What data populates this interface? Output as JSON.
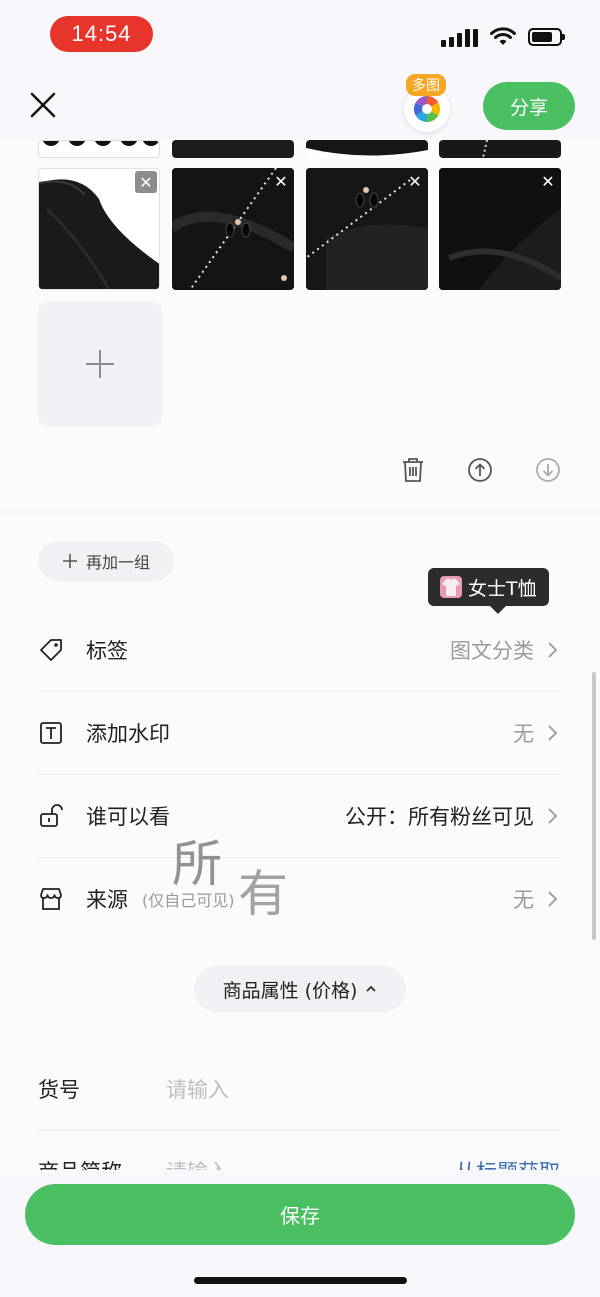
{
  "status_bar": {
    "time": "14:54"
  },
  "nav": {
    "multi_badge": "多图",
    "share_label": "分享"
  },
  "add_group_label": "再加一组",
  "tooltip": {
    "text": "女士T恤"
  },
  "rows": [
    {
      "label": "标签",
      "value": "图文分类"
    },
    {
      "label": "添加水印",
      "value": "无"
    },
    {
      "label": "谁可以看",
      "value": "公开：所有粉丝可见"
    },
    {
      "label": "来源",
      "sub": "(仅自己可见)",
      "value": "无"
    }
  ],
  "overlay": {
    "char1": "所",
    "char2": "有"
  },
  "attr_toggle": {
    "label": "商品属性 (价格)"
  },
  "fields": [
    {
      "label": "货号",
      "placeholder": "请输入"
    },
    {
      "label": "商品简称",
      "placeholder": "请输入",
      "link": "从标题获取"
    }
  ],
  "footer": {
    "save_label": "保存"
  },
  "colors": {
    "accent": "#4ac063",
    "time_pill": "#e8352c",
    "multi_badge": "#f5a623"
  }
}
